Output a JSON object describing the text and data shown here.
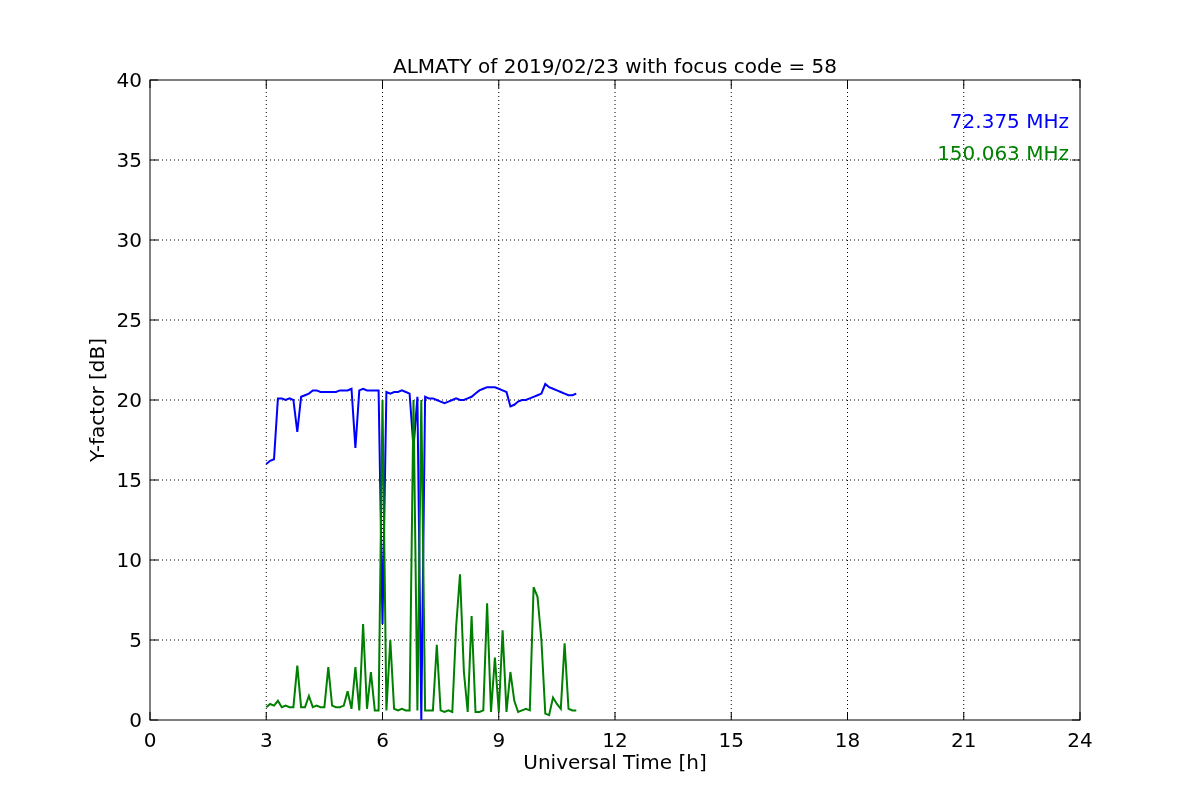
{
  "chart_data": {
    "type": "line",
    "title": "ALMATY of 2019/02/23 with focus code = 58",
    "xlabel": "Universal Time [h]",
    "ylabel": "Y-factor [dB]",
    "x": [
      3.0,
      3.1,
      3.2,
      3.3,
      3.4,
      3.5,
      3.6,
      3.7,
      3.8,
      3.9,
      4.0,
      4.1,
      4.2,
      4.3,
      4.4,
      4.5,
      4.6,
      4.7,
      4.8,
      4.9,
      5.0,
      5.1,
      5.2,
      5.3,
      5.4,
      5.5,
      5.6,
      5.7,
      5.8,
      5.9,
      6.0,
      6.1,
      6.2,
      6.3,
      6.4,
      6.5,
      6.6,
      6.7,
      6.8,
      6.9,
      7.0,
      7.1,
      7.2,
      7.3,
      7.4,
      7.5,
      7.6,
      7.7,
      7.8,
      7.9,
      8.0,
      8.1,
      8.2,
      8.3,
      8.4,
      8.5,
      8.6,
      8.7,
      8.8,
      8.9,
      9.0,
      9.1,
      9.2,
      9.3,
      9.4,
      9.5,
      9.6,
      9.7,
      9.8,
      9.9,
      10.0,
      10.1,
      10.2,
      10.3,
      10.4,
      10.5,
      10.6,
      10.7,
      10.8,
      10.9,
      11.0
    ],
    "series": [
      {
        "name": "72.375 MHz",
        "color": "#0000ff",
        "values": [
          16,
          16.2,
          16.3,
          20.1,
          20.1,
          20,
          20.1,
          20,
          18,
          20.2,
          20.3,
          20.4,
          20.6,
          20.6,
          20.5,
          20.5,
          20.5,
          20.5,
          20.5,
          20.6,
          20.6,
          20.6,
          20.7,
          17,
          20.6,
          20.7,
          20.6,
          20.6,
          20.6,
          20.6,
          6,
          20.5,
          20.4,
          20.5,
          20.5,
          20.6,
          20.5,
          20.4,
          17,
          20.2,
          0,
          20.2,
          20.1,
          20.1,
          20,
          19.9,
          19.8,
          19.9,
          20,
          20.1,
          20,
          20,
          20.1,
          20.2,
          20.4,
          20.6,
          20.7,
          20.8,
          20.8,
          20.8,
          20.7,
          20.6,
          20.5,
          19.6,
          19.7,
          19.9,
          20,
          20,
          20.1,
          20.2,
          20.3,
          20.4,
          21,
          20.8,
          20.7,
          20.6,
          20.5,
          20.4,
          20.3,
          20.3,
          20.4
        ]
      },
      {
        "name": "150.063 MHz",
        "color": "#008000",
        "values": [
          0.8,
          1.0,
          0.9,
          1.2,
          0.8,
          0.9,
          0.8,
          0.8,
          3.4,
          0.8,
          0.8,
          1.5,
          0.8,
          0.9,
          0.8,
          0.8,
          3.3,
          0.9,
          0.8,
          0.8,
          0.9,
          1.8,
          0.7,
          3.3,
          0.6,
          6.0,
          0.7,
          3.0,
          0.6,
          0.6,
          20.0,
          0.6,
          5.0,
          0.7,
          0.6,
          0.7,
          0.6,
          0.6,
          20.0,
          0.6,
          20.0,
          0.6,
          0.6,
          0.6,
          4.7,
          0.6,
          0.5,
          0.6,
          0.5,
          5.8,
          9.1,
          3.0,
          0.5,
          6.5,
          0.5,
          0.5,
          0.6,
          7.3,
          0.5,
          3.9,
          0.5,
          5.6,
          0.5,
          3.0,
          1.2,
          0.5,
          0.6,
          0.7,
          0.6,
          8.3,
          7.7,
          5.0,
          0.4,
          0.3,
          1.4,
          1.0,
          0.7,
          4.8,
          0.7,
          0.6,
          0.6
        ]
      }
    ],
    "grid": true,
    "xlim": [
      0,
      24
    ],
    "ylim": [
      0,
      40
    ],
    "xticks": [
      0,
      3,
      6,
      9,
      12,
      15,
      18,
      21,
      24
    ],
    "yticks": [
      0,
      5,
      10,
      15,
      20,
      25,
      30,
      35,
      40
    ]
  }
}
